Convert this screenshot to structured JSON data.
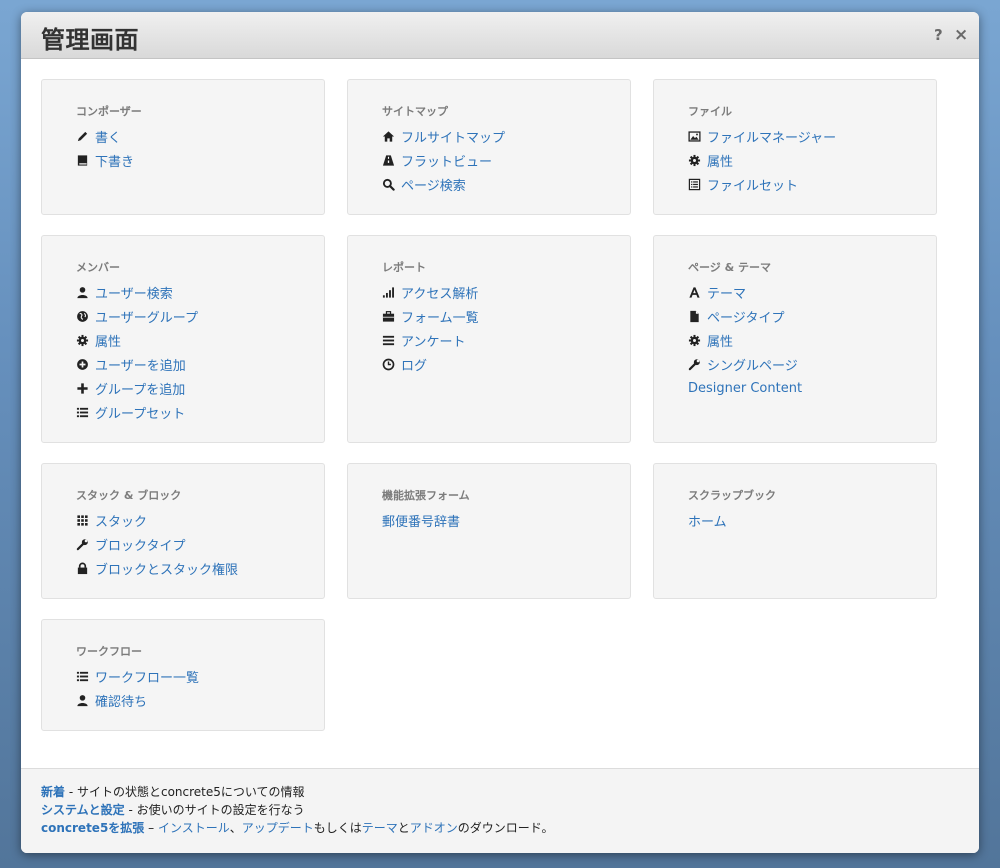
{
  "window": {
    "title": "管理画面",
    "help_label": "?",
    "close_label": "×"
  },
  "panels": {
    "composer": {
      "title": "コンポーザー",
      "items": [
        "書く",
        "下書き"
      ]
    },
    "sitemap": {
      "title": "サイトマップ",
      "items": [
        "フルサイトマップ",
        "フラットビュー",
        "ページ検索"
      ]
    },
    "files": {
      "title": "ファイル",
      "items": [
        "ファイルマネージャー",
        "属性",
        "ファイルセット"
      ]
    },
    "members": {
      "title": "メンバー",
      "items": [
        "ユーザー検索",
        "ユーザーグループ",
        "属性",
        "ユーザーを追加",
        "グループを追加",
        "グループセット"
      ]
    },
    "reports": {
      "title": "レポート",
      "items": [
        "アクセス解析",
        "フォーム一覧",
        "アンケート",
        "ログ"
      ]
    },
    "pages_themes": {
      "title": "ページ & テーマ",
      "items": [
        "テーマ",
        "ページタイプ",
        "属性",
        "シングルページ",
        "Designer Content"
      ]
    },
    "stacks_blocks": {
      "title": "スタック & ブロック",
      "items": [
        "スタック",
        "ブロックタイプ",
        "ブロックとスタック権限"
      ]
    },
    "extended_form": {
      "title": "機能拡張フォーム",
      "items": [
        "郵便番号辞書"
      ]
    },
    "scrapbook": {
      "title": "スクラップブック",
      "items": [
        "ホーム"
      ]
    },
    "workflow": {
      "title": "ワークフロー",
      "items": [
        "ワークフロー一覧",
        "確認待ち"
      ]
    }
  },
  "footer": {
    "news_link": "新着",
    "news_text": " - サイトの状態とconcrete5についての情報",
    "system_link": "システムと設定",
    "system_text": " - お使いのサイトの設定を行なう",
    "extend_link": "concrete5を拡張",
    "extend_sep": " – ",
    "install_link": "インストール",
    "comma": "、",
    "update_link": "アップデート",
    "or_text": "もしくは",
    "theme_link": "テーマ",
    "and_text": "と",
    "addon_link": "アドオン",
    "tail_text": "のダウンロード。"
  },
  "colors": {
    "link": "#2e73b9",
    "panel_bg": "#f5f5f5",
    "title_text": "#333333"
  }
}
